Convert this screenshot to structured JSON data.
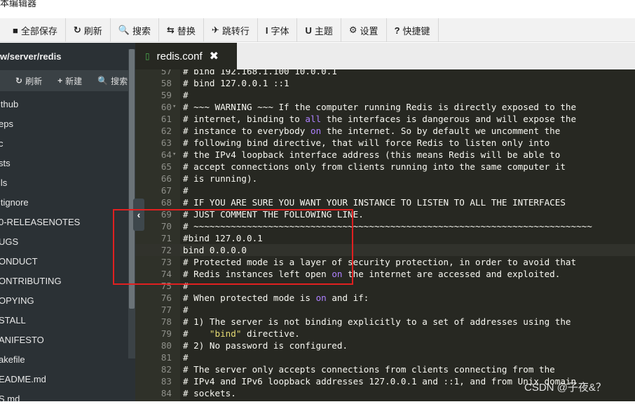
{
  "window": {
    "title": "本编辑器"
  },
  "toolbar": [
    {
      "icon": "■",
      "icon_name": "save-icon",
      "label": "全部保存"
    },
    {
      "icon": "↻",
      "icon_name": "refresh-icon",
      "label": "刷新"
    },
    {
      "icon": "🔍",
      "icon_name": "search-icon",
      "label": "搜索"
    },
    {
      "icon": "⇆",
      "icon_name": "replace-icon",
      "label": "替换"
    },
    {
      "icon": "✈",
      "icon_name": "jump-icon",
      "label": "跳转行"
    },
    {
      "icon": "I",
      "icon_name": "font-icon",
      "label": "字体"
    },
    {
      "icon": "U",
      "icon_name": "theme-icon",
      "label": "主题"
    },
    {
      "icon": "⚙",
      "icon_name": "gear-icon",
      "label": "设置"
    },
    {
      "icon": "?",
      "icon_name": "help-icon",
      "label": "快捷键"
    }
  ],
  "sidebar": {
    "path": "w/server/redis",
    "tools": [
      {
        "icon": "↻",
        "icon_name": "refresh-icon",
        "label": "刷新"
      },
      {
        "icon": "+",
        "icon_name": "plus-icon",
        "label": "新建"
      },
      {
        "icon": "🔍",
        "icon_name": "search-icon",
        "label": "搜索"
      }
    ],
    "files": [
      "ithub",
      "eps",
      "c",
      "sts",
      "ils",
      "itignore",
      "0-RELEASENOTES",
      "UGS",
      "ONDUCT",
      "ONTRIBUTING",
      "OPYING",
      "STALL",
      "ANIFESTO",
      "akefile",
      "EADME.md",
      "S.md"
    ]
  },
  "tab": {
    "name": "redis.conf",
    "close": "✖"
  },
  "editor": {
    "lines": [
      {
        "n": "57",
        "t": "# bind 192.168.1.100 10.0.0.1"
      },
      {
        "n": "58",
        "t": "# bind 127.0.0.1 ::1"
      },
      {
        "n": "59",
        "t": "#"
      },
      {
        "n": "60",
        "fold": true,
        "t": "# ~~~ WARNING ~~~ If the computer running Redis is directly exposed to the"
      },
      {
        "n": "61",
        "t": "# internet, binding to {all} the interfaces is dangerous and will expose the"
      },
      {
        "n": "62",
        "t": "# instance to everybody {on} the internet. So by default we uncomment the"
      },
      {
        "n": "63",
        "t": "# following bind directive, that will force Redis to listen only into"
      },
      {
        "n": "64",
        "fold": true,
        "t": "# the IPv4 loopback interface address (this means Redis will be able to"
      },
      {
        "n": "65",
        "t": "# accept connections only from clients running into the same computer it"
      },
      {
        "n": "66",
        "t": "# is running)."
      },
      {
        "n": "67",
        "t": "#"
      },
      {
        "n": "68",
        "t": "# IF YOU ARE SURE YOU WANT YOUR INSTANCE TO LISTEN TO ALL THE INTERFACES"
      },
      {
        "n": "69",
        "t": "# JUST COMMENT THE FOLLOWING LINE."
      },
      {
        "n": "70",
        "t": "# ~~~~~~~~~~~~~~~~~~~~~~~~~~~~~~~~~~~~~~~~~~~~~~~~~~~~~~~~~~~~~~~~~~~~~~~~~~~"
      },
      {
        "n": "71",
        "t": "#bind 127.0.0.1"
      },
      {
        "n": "72",
        "t": "bind 0.0.0.0",
        "active": true
      },
      {
        "n": "73",
        "t": "# Protected mode is a layer of security protection, in order to avoid that"
      },
      {
        "n": "74",
        "t": "# Redis instances left open {on} the internet are accessed and exploited."
      },
      {
        "n": "75",
        "t": "#"
      },
      {
        "n": "76",
        "t": "# When protected mode is {on} and if:"
      },
      {
        "n": "77",
        "t": "#"
      },
      {
        "n": "78",
        "t": "# 1) The server is not binding explicitly to a set of addresses using the"
      },
      {
        "n": "79",
        "t": "#    [\"bind\"] directive."
      },
      {
        "n": "80",
        "t": "# 2) No password is configured."
      },
      {
        "n": "81",
        "t": "#"
      },
      {
        "n": "82",
        "t": "# The server only accepts connections from clients connecting from the"
      },
      {
        "n": "83",
        "t": "# IPv4 and IPv6 loopback addresses 127.0.0.1 and ::1, and from Unix domain"
      },
      {
        "n": "84",
        "t": "# sockets."
      }
    ]
  },
  "collapse_handle": "‹",
  "watermark": "CSDN @子夜&？",
  "colors": {
    "editor_bg": "#272822",
    "keyword": "#ae81ff",
    "string": "#e6db74",
    "highlight_box": "#e02020"
  }
}
